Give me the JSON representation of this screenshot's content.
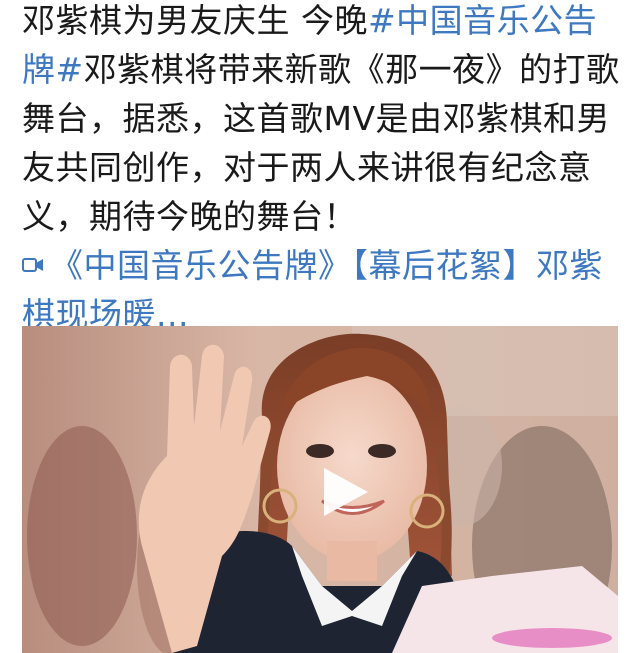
{
  "post": {
    "text_part1": "邓紫棋为男友庆生 今晚",
    "topic": "#中国音乐公告牌#",
    "text_part2": "邓紫棋将带来新歌《那一夜》的打歌舞台，据悉，这首歌MV是由邓紫棋和男友共同创作，对于两人来讲很有纪念意义，期待今晚的舞台！",
    "video_link_text": "《中国音乐公告牌》【幕后花絮】邓紫棋现场暖...",
    "video_link_icon": "video-camera-icon"
  },
  "video": {
    "play_icon": "play-icon",
    "colors": {
      "background": "#c9a99a",
      "link": "#3d78c0",
      "text": "#1a1a1a"
    }
  }
}
